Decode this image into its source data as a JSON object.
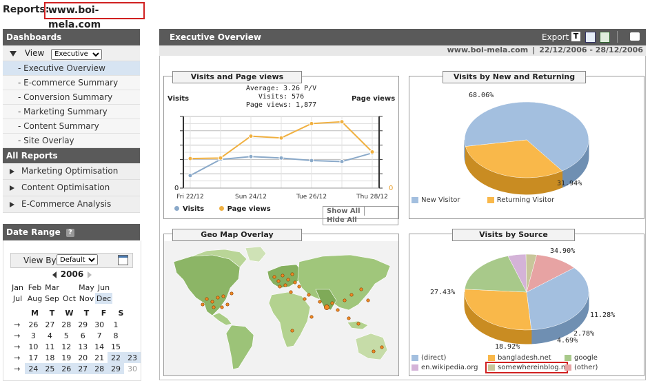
{
  "header": {
    "reports_label": "Reports:",
    "site": "www.boi-mela.com"
  },
  "sidebar": {
    "dashboards_title": "Dashboards",
    "view_label": "View",
    "view_value": "Executive",
    "items": [
      {
        "label": "- Executive Overview"
      },
      {
        "label": "- E-commerce Summary"
      },
      {
        "label": "- Conversion Summary"
      },
      {
        "label": "- Marketing Summary"
      },
      {
        "label": "- Content Summary"
      },
      {
        "label": "- Site Overlay"
      }
    ],
    "all_reports_title": "All Reports",
    "reports": [
      {
        "label": "Marketing Optimisation"
      },
      {
        "label": "Content Optimisation"
      },
      {
        "label": "E-Commerce Analysis"
      }
    ],
    "date_range_title": "Date Range",
    "view_by_label": "View By",
    "view_by_value": "Default",
    "year": "2006",
    "months": [
      [
        "Jan",
        "Feb",
        "Mar",
        "May",
        "Jun"
      ],
      [
        "Jul",
        "Aug",
        "Sep",
        "Oct",
        "Nov",
        "Dec"
      ]
    ],
    "weekday_headers": [
      "M",
      "T",
      "W",
      "T",
      "F",
      "S"
    ],
    "weeks": [
      [
        "26",
        "27",
        "28",
        "29",
        "30",
        "1"
      ],
      [
        "3",
        "4",
        "5",
        "6",
        "7",
        "8"
      ],
      [
        "10",
        "11",
        "12",
        "13",
        "14",
        "15"
      ],
      [
        "17",
        "18",
        "19",
        "20",
        "21",
        "22",
        "23"
      ],
      [
        "24",
        "25",
        "26",
        "27",
        "28",
        "29",
        "30"
      ]
    ]
  },
  "main": {
    "title": "Executive Overview",
    "export_label": "Export",
    "site": "www.boi-mela.com",
    "date_range": "22/12/2006 - 28/12/2006",
    "visits_chart": {
      "title": "Visits and Page views",
      "left_label": "Visits",
      "right_label": "Page views",
      "stats": [
        "Average: 3.26 P/V",
        "Visits: 576",
        "Page views: 1,877"
      ],
      "left_zero": "0",
      "right_zero": "0",
      "show_all": "Show All",
      "hide_all": "Hide All"
    },
    "new_returning": {
      "title": "Visits by New and Returning",
      "pct_new": "68.06%",
      "pct_ret": "31.94%"
    },
    "geo": {
      "title": "Geo Map Overlay"
    },
    "source": {
      "title": "Visits by Source",
      "pcts": {
        "direct": "34.90%",
        "bangladesh": "27.43%",
        "google": "18.92%",
        "wiki": "4.69%",
        "some": "2.78%",
        "other": "11.28%"
      }
    },
    "colors": {
      "blue": "#a3bfdf",
      "orange": "#f9b84a",
      "green": "#a8c98a",
      "purple": "#d4b3d8",
      "olive": "#c8c69a",
      "pink": "#e7a3a3",
      "accent_red": "#d02020"
    }
  },
  "chart_data": [
    {
      "type": "line",
      "title": "Visits and Page views",
      "x": [
        "Fri 22/12",
        "Sat 23/12",
        "Sun 24/12",
        "Mon 25/12",
        "Tue 26/12",
        "Wed 27/12",
        "Thu 28/12"
      ],
      "x_tick_labels": [
        "Fri 22/12",
        "Sun 24/12",
        "Tue 26/12",
        "Thu 28/12"
      ],
      "series": [
        {
          "name": "Visits",
          "values": [
            35,
            80,
            88,
            84,
            77,
            74,
            98
          ]
        },
        {
          "name": "Page views",
          "values": [
            165,
            168,
            290,
            280,
            360,
            370,
            202
          ]
        }
      ],
      "legend": [
        "Visits",
        "Page views"
      ]
    },
    {
      "type": "pie",
      "title": "Visits by New and Returning",
      "labels": [
        "New Visitor",
        "Returning Visitor"
      ],
      "values": [
        68.06,
        31.94
      ]
    },
    {
      "type": "pie",
      "title": "Visits by Source",
      "labels": [
        "(direct)",
        "bangladesh.net",
        "google",
        "en.wikipedia.org",
        "somewhereinblog.n",
        "(other)"
      ],
      "values": [
        34.9,
        27.43,
        18.92,
        4.69,
        2.78,
        11.28
      ]
    }
  ]
}
